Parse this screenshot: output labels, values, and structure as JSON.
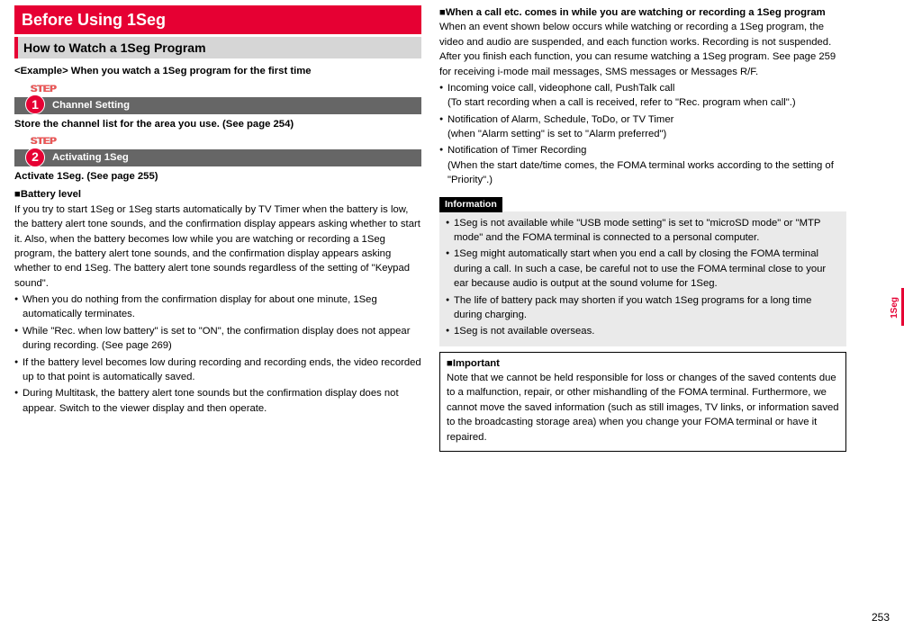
{
  "section": {
    "title": "Before Using 1Seg",
    "subtitle": "How to Watch a 1Seg Program",
    "example_title": "<Example> When you watch a 1Seg program for the first time",
    "step_label": "STEP",
    "step1_num": "1",
    "step1_title": "Channel Setting",
    "store_line": "Store the channel list for the area you use. (See page 254)",
    "step2_num": "2",
    "step2_title": "Activating 1Seg",
    "activate_line": "Activate 1Seg. (See page 255)"
  },
  "battery": {
    "heading_text": "Battery level",
    "para": "If you try to start 1Seg or 1Seg starts automatically by TV Timer when the battery is low, the battery alert tone sounds, and the confirmation display appears asking whether to start it. Also, when the battery becomes low while you are watching or recording a 1Seg program, the battery alert tone sounds, and the confirmation display appears asking whether to end 1Seg. The battery alert tone sounds regardless of the setting of \"Keypad sound\".",
    "bullets": [
      "When you do nothing from the confirmation display for about one minute, 1Seg automatically terminates.",
      "While \"Rec. when low battery\" is set to \"ON\", the confirmation display does not appear during recording. (See page 269)",
      "If the battery level becomes low during recording and recording ends, the video recorded up to that point is automatically saved.",
      "During Multitask, the battery alert tone sounds but the confirmation display does not appear. Switch to the viewer display and then operate."
    ]
  },
  "call": {
    "heading_text": "When a call etc. comes in while you are watching or recording a 1Seg program",
    "para": "When an event shown below occurs while watching or recording a 1Seg program, the video and audio are suspended, and each function works. Recording is not suspended. After you finish each function, you can resume watching a 1Seg program. See page 259 for receiving i-mode mail messages, SMS messages or Messages R/F.",
    "b1": "Incoming voice call, videophone call, PushTalk call",
    "b1_sub": "(To start recording when a call is received, refer to \"Rec. program when call\".)",
    "b2": "Notification of Alarm, Schedule, ToDo, or TV Timer",
    "b2_sub": "(when \"Alarm setting\" is set to \"Alarm preferred\")",
    "b3": "Notification of Timer Recording",
    "b3_sub": "(When the start date/time comes, the FOMA terminal works according to the setting of \"Priority\".)"
  },
  "info": {
    "header": "Information",
    "bullets": [
      "1Seg is not available while \"USB mode setting\" is set to \"microSD mode\" or \"MTP mode\" and the FOMA terminal is connected to a personal computer.",
      "1Seg might automatically start when you end a call by closing the FOMA terminal during a call. In such a case, be careful not to use the FOMA terminal close to your ear because audio is output at the sound volume for 1Seg.",
      "The life of battery pack may shorten if you watch 1Seg programs for a long time during charging.",
      "1Seg is not available overseas."
    ]
  },
  "important": {
    "heading_text": "Important",
    "para": "Note that we cannot be held responsible for loss or changes of the saved contents due to a malfunction, repair, or other mishandling of the FOMA terminal. Furthermore, we cannot move the saved information (such as still images, TV links, or information saved to the broadcasting storage area) when you change your FOMA terminal or have it repaired."
  },
  "side_tab": "1Seg",
  "page_num": "253"
}
